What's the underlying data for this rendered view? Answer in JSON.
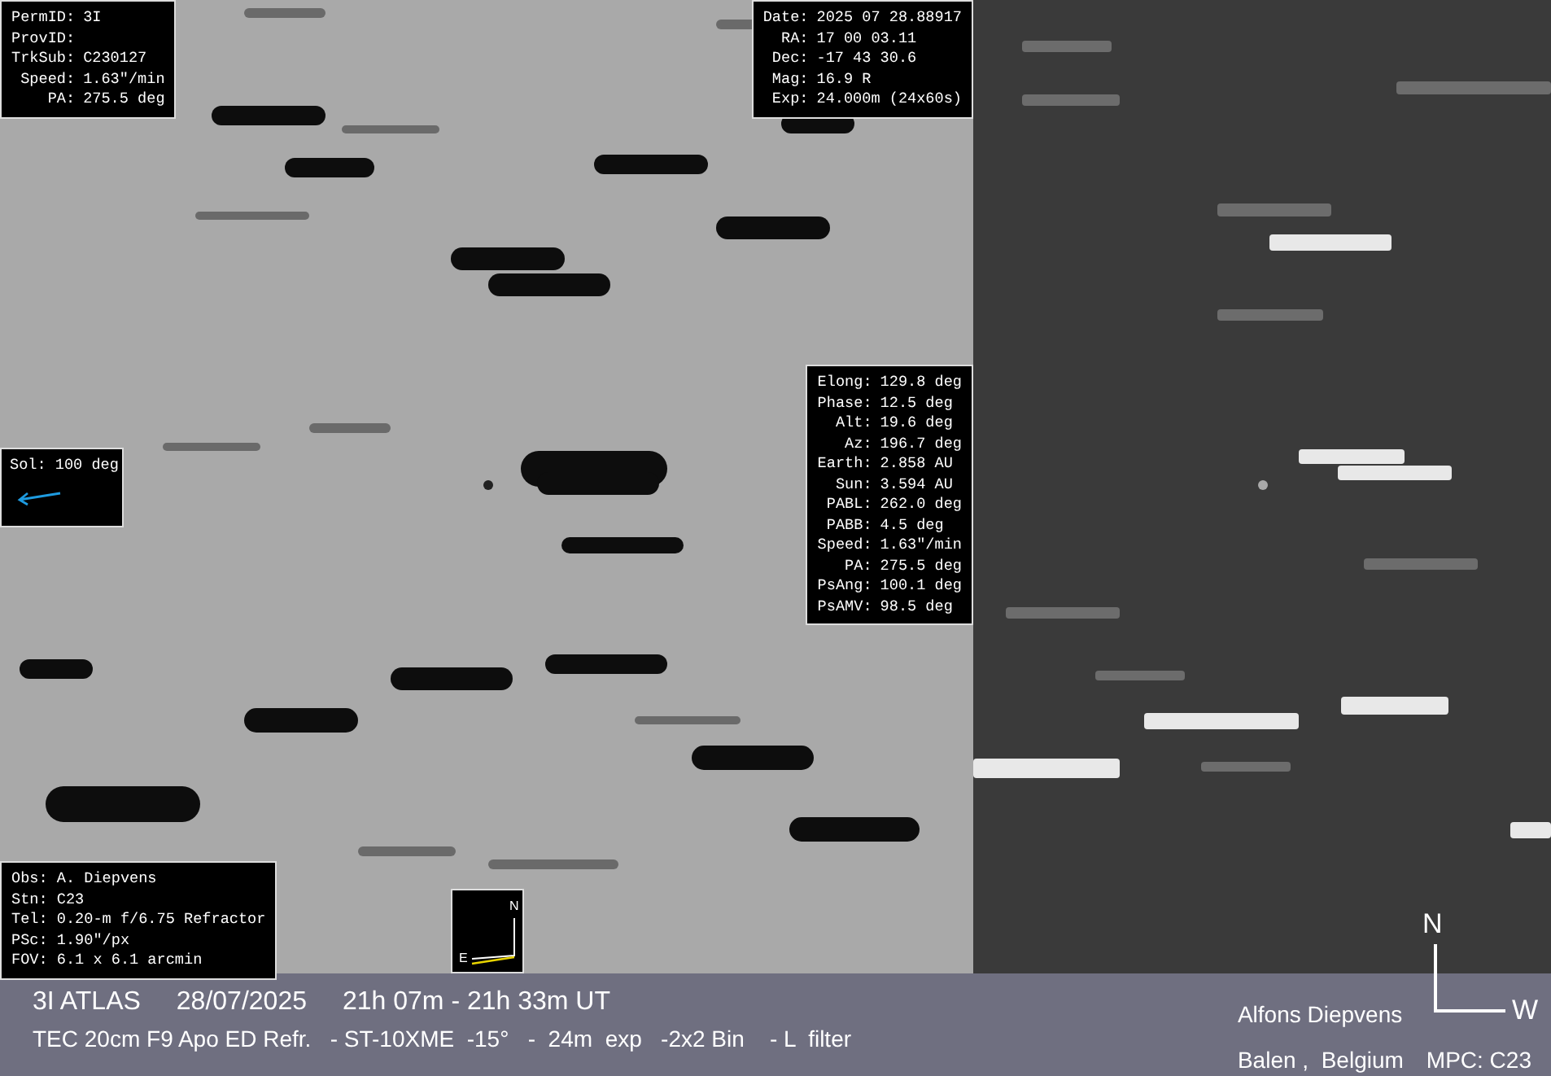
{
  "left_image": {
    "id_box": [
      {
        "label": "PermID:",
        "value": "3I"
      },
      {
        "label": "ProvID:"
      },
      {
        "label": "TrkSub:",
        "value": "C230127"
      },
      {
        "label": "Speed:",
        "value": "1.63\"/min"
      },
      {
        "label": "PA:",
        "value": "275.5 deg"
      }
    ],
    "date_box": [
      {
        "label": "Date:",
        "value": "2025 07 28.88917"
      },
      {
        "label": "RA:",
        "value": "17 00 03.11"
      },
      {
        "label": "Dec:",
        "value": "-17 43 30.6"
      },
      {
        "label": "Mag:",
        "value": "16.9 R"
      },
      {
        "label": "Exp:",
        "value": "24.000m (24x60s)"
      }
    ],
    "ephemeris_box": [
      {
        "label": "Elong:",
        "value": "129.8 deg"
      },
      {
        "label": "Phase:",
        "value": "12.5 deg"
      },
      {
        "label": "Alt:",
        "value": "19.6 deg"
      },
      {
        "label": "Az:",
        "value": "196.7 deg"
      },
      {
        "label": "Earth:",
        "value": "2.858 AU"
      },
      {
        "label": "Sun:",
        "value": "3.594 AU"
      },
      {
        "label": "PABL:",
        "value": "262.0 deg"
      },
      {
        "label": "PABB:",
        "value": "4.5 deg"
      },
      {
        "label": "Speed:",
        "value": "1.63\"/min"
      },
      {
        "label": "PA:",
        "value": "275.5 deg"
      },
      {
        "label": "PsAng:",
        "value": "100.1 deg"
      },
      {
        "label": "PsAMV:",
        "value": "98.5 deg"
      }
    ],
    "sol_box": {
      "text": "Sol: 100 deg"
    },
    "observer_box": [
      "Obs: A. Diepvens",
      "Stn: C23",
      "Tel: 0.20-m f/6.75 Refractor",
      "PSc: 1.90\"/px",
      "FOV: 6.1 x 6.1 arcmin"
    ],
    "compass": {
      "north": "N",
      "east": "E"
    }
  },
  "right_image": {
    "compass": {
      "north": "N",
      "west": "W"
    }
  },
  "caption": {
    "object": "3I ATLAS",
    "date": "28/07/2025",
    "time": "21h 07m - 21h 33m UT",
    "equipment": "TEC 20cm F9 Apo ED Refr.   - ST-10XME  -15°   -  24m  exp   -2x2 Bin    - L  filter",
    "author": "Alfons Diepvens",
    "location": "Balen ,  Belgium",
    "mpc": "MPC: C23"
  }
}
